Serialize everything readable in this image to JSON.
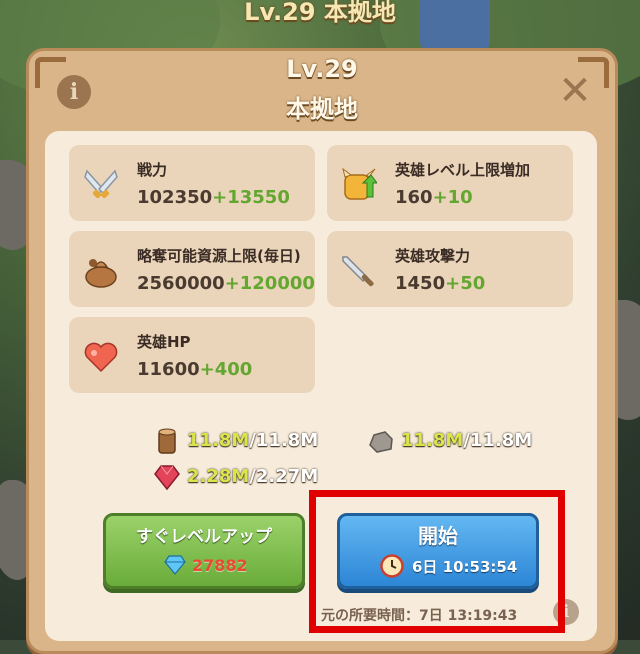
{
  "background": {
    "title": "Lv.29 本拠地"
  },
  "panel": {
    "level": "Lv.29",
    "name": "本拠地",
    "info_icon": "info-icon",
    "close_icon": "close-icon"
  },
  "stats": [
    {
      "icon": "swords-icon",
      "label": "戦力",
      "value": "102350",
      "add": "+13550"
    },
    {
      "icon": "hero-level-up-icon",
      "label": "英雄レベル上限増加",
      "value": "160",
      "add": "+10"
    },
    {
      "icon": "loot-bag-icon",
      "label": "略奪可能資源上限(毎日)",
      "value": "2560000",
      "add": "+120000"
    },
    {
      "icon": "sword-icon",
      "label": "英雄攻撃力",
      "value": "1450",
      "add": "+50"
    },
    {
      "icon": "heart-icon",
      "label": "英雄HP",
      "value": "11600",
      "add": "+400"
    }
  ],
  "resources": [
    {
      "icon": "wood-icon",
      "have": "11.8M",
      "need": "/11.8M"
    },
    {
      "icon": "stone-icon",
      "have": "11.8M",
      "need": "/11.8M"
    },
    {
      "icon": "ruby-icon",
      "have": "2.28M",
      "need": "/2.27M"
    }
  ],
  "instant_button": {
    "label": "すぐレベルアップ",
    "icon": "gem-icon",
    "cost": "27882"
  },
  "start_button": {
    "label": "開始",
    "icon": "clock-icon",
    "time": "6日 10:53:54"
  },
  "original_time": "元の所要時間：7日 13:19:43",
  "colors": {
    "accent_green": "#63a630",
    "highlight": "#e00000",
    "blue_button": "#2d86d6"
  }
}
